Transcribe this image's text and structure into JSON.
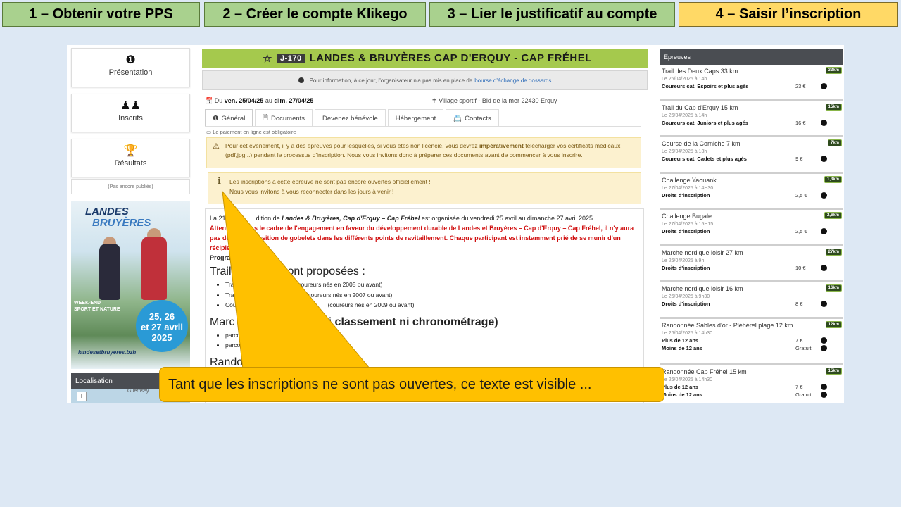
{
  "steps": [
    {
      "label": "1 – Obtenir votre PPS"
    },
    {
      "label": "2 – Créer le compte Klikego"
    },
    {
      "label": "3 – Lier le justificatif au compte"
    },
    {
      "label": "4 – Saisir l’inscription"
    }
  ],
  "nav": {
    "presentation": "Présentation",
    "inscrits": "Inscrits",
    "resultats": "Résultats",
    "results_note": "(Pas encore publiés)",
    "localisation": "Localisation",
    "map_label": "Guernsey",
    "zoom_in": "+"
  },
  "poster": {
    "title1": "LANDES",
    "title2": "BRUYÈRES",
    "weekend1": "WEEK-END",
    "weekend2": "SPORT ET NATURE",
    "dates1": "25, 26",
    "dates2": "et 27 avril",
    "dates3": "2025",
    "site": "landesetbruyeres.bzh"
  },
  "event": {
    "badge": "J-170",
    "title": "LANDES & BRUYÈRES CAP D'ERQUY - CAP FRÉHEL",
    "info_text": "Pour information, à ce jour, l'organisateur n'a pas mis en place de",
    "info_link": "bourse d'échange de dossards",
    "date_prefix": "Du",
    "date_from": "ven. 25/04/25",
    "date_mid": "au",
    "date_to": "dim. 27/04/25",
    "venue": "Village sportif - Bld de la mer 22430 Erquy",
    "payment_note": "Le paiement en ligne est obligatoire"
  },
  "tabs": [
    {
      "label": "Général"
    },
    {
      "label": "Documents"
    },
    {
      "label": "Devenez bénévole"
    },
    {
      "label": "Hébergement"
    },
    {
      "label": "Contacts"
    }
  ],
  "warning": {
    "pre": "Pour cet événement, il y a des épreuves pour lesquelles, si vous êtes non licencié, vous devrez",
    "strong": "impérativement",
    "post": "télécharger vos certificats médicaux (pdf,jpg...) pendant le processus d'inscription. Nous vous invitons donc à préparer ces documents avant de commencer à vous inscrire."
  },
  "closed": {
    "line1": "Les inscriptions à cette épreuve ne sont pas encore ouvertes officiellement !",
    "line2": "Nous vous invitons à vous reconnecter dans les jours à venir !"
  },
  "desc": {
    "intro_a": "La 21",
    "intro_b": "dition de",
    "intro_event": "Landes & Bruyères, Cap d'Erquy – Cap Fréhel",
    "intro_c": "est organisée du vendredi 25 avril au dimanche 27 avril 2025.",
    "red1": "Atten",
    "red1b": "s le cadre de l'engagement en faveur du développement durable de Landes et Bruyères – Cap d'Erquy – Cap Fréhel, il n'y aura",
    "red2": "pas de",
    "red2b": "osition de gobelets dans les différents points de ravitaillement. Chaque participant est instamment prié de se munir d'un",
    "red3": "récipie",
    "prog": "Progra",
    "h1a": "Trail",
    "h1b": "sont proposées :",
    "li1a": "Tra",
    "li1b": "(coureurs nés en 2005 ou avant)",
    "li2a": "Tra",
    "li2b": "(coureurs nés en 2007 ou avant)",
    "li3a": "Cou",
    "li3b": "(coureurs nés en 2009 ou avant)",
    "h2a": "Marc",
    "h2b": "(ni classement ni chronométrage)",
    "li4": "parco",
    "li5": "parco",
    "h3": "Rando"
  },
  "races_title": "Epreuves",
  "races": [
    {
      "name": "Trail des Deux Caps 33 km",
      "date": "Le 26/04/2025 à 14h",
      "km": "33km",
      "lines": [
        {
          "cat": "Coureurs cat. Espoirs et plus agés",
          "price": "23 €"
        }
      ]
    },
    {
      "name": "Trail du Cap d'Erquy 15 km",
      "date": "Le 26/04/2025 à 14h",
      "km": "15km",
      "lines": [
        {
          "cat": "Coureurs cat. Juniors et plus agés",
          "price": "16 €"
        }
      ]
    },
    {
      "name": "Course de la Corniche 7 km",
      "date": "Le 26/04/2025 à 13h",
      "km": "7km",
      "lines": [
        {
          "cat": "Coureurs cat. Cadets et plus agés",
          "price": "9 €"
        }
      ]
    },
    {
      "name": "Challenge Yaouank",
      "date": "Le 27/04/2025 à 14H30",
      "km": "1,3km",
      "lines": [
        {
          "cat": "Droits d'inscription",
          "price": "2,5 €"
        }
      ]
    },
    {
      "name": "Challenge Bugale",
      "date": "Le 27/04/2025 à 15H15",
      "km": "2,6km",
      "lines": [
        {
          "cat": "Droits d'inscription",
          "price": "2,5 €"
        }
      ]
    },
    {
      "name": "Marche nordique loisir 27 km",
      "date": "Le 26/04/2025 à 9h",
      "km": "27km",
      "lines": [
        {
          "cat": "Droits d'inscription",
          "price": "10 €"
        }
      ]
    },
    {
      "name": "Marche nordique loisir 16 km",
      "date": "Le 26/04/2025 à 9h30",
      "km": "16km",
      "lines": [
        {
          "cat": "Droits d'inscription",
          "price": "8 €"
        }
      ]
    },
    {
      "name": "Randonnée Sables d'or - Pléhérel plage 12 km",
      "date": "Le 26/04/2025 à 14h30",
      "km": "12km",
      "lines": [
        {
          "cat": "Plus de 12 ans",
          "price": "7 €"
        },
        {
          "cat": "Moins de 12 ans",
          "price": "Gratuit"
        }
      ]
    },
    {
      "name": "Randonnée Cap Fréhel 15 km",
      "date": "Le 26/04/2025 à 14h30",
      "km": "15km",
      "lines": [
        {
          "cat": "Plus de 12 ans",
          "price": "7 €"
        },
        {
          "cat": "Moins de 12 ans",
          "price": "Gratuit"
        }
      ]
    }
  ],
  "callout": {
    "text": "Tant que les inscriptions ne sont pas ouvertes, ce texte est visible ..."
  },
  "colors": {
    "step_green": "#a9d18e",
    "step_yellow": "#ffd966",
    "title_bar": "#a5c94d",
    "callout": "#ffc000"
  }
}
